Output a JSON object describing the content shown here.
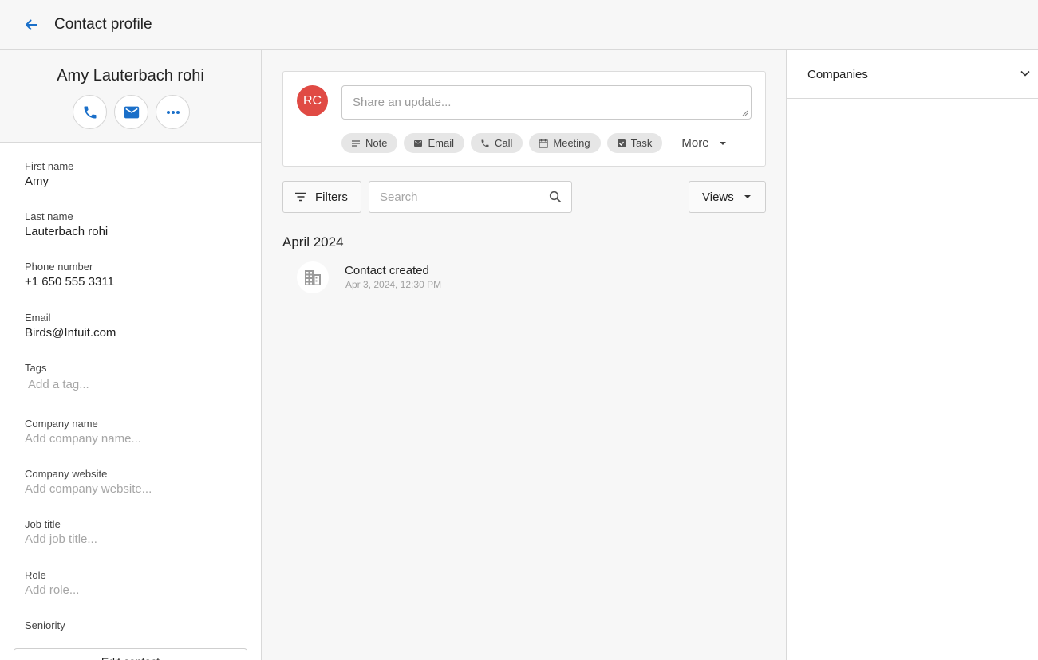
{
  "header": {
    "title": "Contact profile",
    "back_icon": "arrow-left-icon"
  },
  "contact": {
    "name": "Amy Lauterbach rohi"
  },
  "actions": [
    {
      "name": "call-action-button",
      "icon": "phone-icon"
    },
    {
      "name": "email-action-button",
      "icon": "mail-icon"
    },
    {
      "name": "more-actions-button",
      "icon": "more-horizontal-icon"
    }
  ],
  "fields": {
    "first_name": {
      "label": "First name",
      "value": "Amy"
    },
    "last_name": {
      "label": "Last name",
      "value": "Lauterbach rohi"
    },
    "phone": {
      "label": "Phone number",
      "value": "+1 650 555 3311"
    },
    "email": {
      "label": "Email",
      "value": "Birds@Intuit.com"
    },
    "tags": {
      "label": "Tags",
      "placeholder": "Add a tag..."
    },
    "company_name": {
      "label": "Company name",
      "placeholder": "Add company name..."
    },
    "company_website": {
      "label": "Company website",
      "placeholder": "Add company website..."
    },
    "job_title": {
      "label": "Job title",
      "placeholder": "Add job title..."
    },
    "role": {
      "label": "Role",
      "placeholder": "Add role..."
    },
    "seniority": {
      "label": "Seniority"
    }
  },
  "footer": {
    "edit_label": "Edit contact"
  },
  "composer": {
    "avatar_initials": "RC",
    "avatar_color": "#e04a44",
    "placeholder": "Share an update...",
    "chips": {
      "note": "Note",
      "email": "Email",
      "call": "Call",
      "meeting": "Meeting",
      "task": "Task"
    },
    "more_label": "More"
  },
  "toolbar": {
    "filters_label": "Filters",
    "search_placeholder": "Search",
    "views_label": "Views"
  },
  "timeline": {
    "month": "April 2024",
    "items": [
      {
        "title": "Contact created",
        "date": "Apr 3, 2024, 12:30 PM",
        "icon": "building-icon"
      }
    ]
  },
  "right_panel": {
    "companies_label": "Companies"
  },
  "colors": {
    "accent": "#1a6fc9",
    "chip_bg": "#e6e6e6"
  }
}
